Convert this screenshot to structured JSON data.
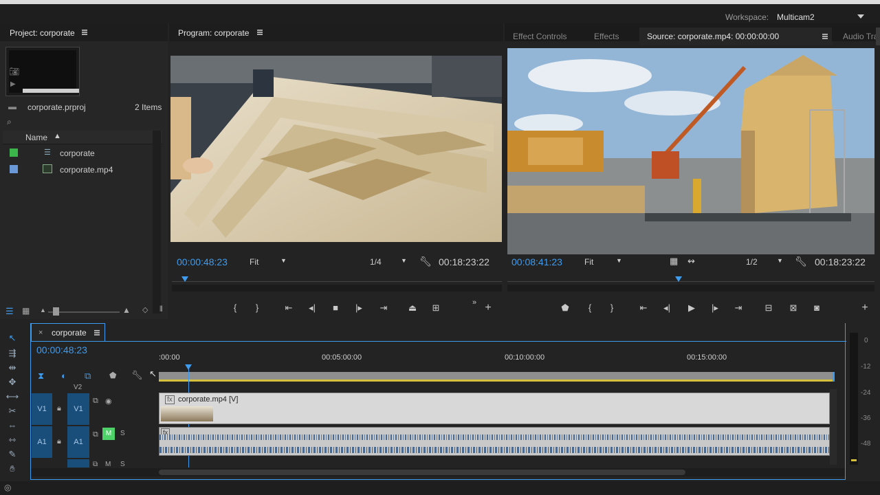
{
  "workspace": {
    "label": "Workspace:",
    "value": "Multicam2"
  },
  "project": {
    "tab_title": "Project: corporate",
    "file": "corporate.prproj",
    "items_count": "2 Items",
    "column_name": "Name",
    "items": [
      {
        "name": "corporate",
        "color": "#3cb54a"
      },
      {
        "name": "corporate.mp4",
        "color": "#6a98d6"
      }
    ]
  },
  "program": {
    "tab_title": "Program: corporate",
    "timecode": "00:00:48:23",
    "fit": "Fit",
    "resolution": "1/4",
    "duration": "00:18:23:22"
  },
  "source": {
    "tabs": [
      "Effect Controls",
      "Effects",
      "Source: corporate.mp4: 00:00:00:00",
      "Audio Tra"
    ],
    "timecode": "00:08:41:23",
    "fit": "Fit",
    "resolution": "1/2",
    "duration": "00:18:23:22"
  },
  "timeline": {
    "sequence_tab": "corporate",
    "close_glyph": "×",
    "timecode": "00:00:48:23",
    "ruler_labels": [
      ":00:00",
      "00:05:00:00",
      "00:10:00:00",
      "00:15:00:00"
    ],
    "tracks": {
      "v2": "V2",
      "v1_left": "V1",
      "v1_right": "V1",
      "a1_left": "A1",
      "a1_right": "A1",
      "mute": "M",
      "solo": "S",
      "a2_mute": "M",
      "a2_solo": "S"
    },
    "video_clip_name": "corporate.mp4 [V]",
    "fx_label": "fx"
  },
  "meter": {
    "labels": [
      "0",
      "-12",
      "-24",
      "-36",
      "-48"
    ]
  },
  "colors": {
    "accent": "#3e9cf0",
    "video_track": "#1a4e7a",
    "in_out_bar": "#d4c03a"
  }
}
